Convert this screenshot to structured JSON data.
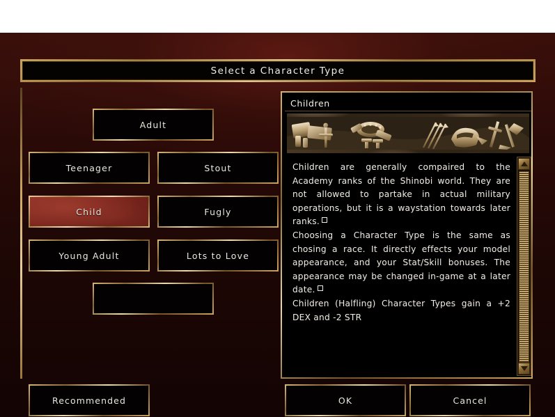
{
  "window": {
    "title": "Select a Character Type"
  },
  "choices": {
    "top": {
      "label": "Adult"
    },
    "grid": [
      {
        "label": "Teenager",
        "selected": false
      },
      {
        "label": "Stout",
        "selected": false
      },
      {
        "label": "Child",
        "selected": true
      },
      {
        "label": "Fugly",
        "selected": false
      },
      {
        "label": "Young Adult",
        "selected": false
      },
      {
        "label": "Lots to Love",
        "selected": false
      }
    ],
    "bottom": {
      "label": ""
    }
  },
  "description": {
    "header": "Children",
    "banner_icon": "weapons-and-armor-banner",
    "paragraphs": [
      "Children are generally compaired to the Academy ranks of the Shinobi world. They are not allowed to partake in actual military operations, but it is a waystation towards later ranks.",
      "Choosing a Character Type is the same as chosing a race. It directly effects your model appearance, and your Stat/Skill bonuses. The appearance may be changed in-game at a later date.",
      "Children (Halfling) Character Types gain a +2 DEX and -2 STR"
    ]
  },
  "scrollbar": {
    "up_icon": "triangle-up-icon",
    "down_icon": "triangle-down-icon"
  },
  "actions": {
    "recommended": "Recommended",
    "ok": "OK",
    "cancel": "Cancel"
  },
  "colors": {
    "gold_light": "#f0dcb0",
    "gold": "#c9a45e",
    "gold_dark": "#6b4f24",
    "selected_red": "#8e2f25",
    "panel_black": "#000000",
    "background_maroon": "#2a0a07",
    "text": "#f2eee6"
  }
}
